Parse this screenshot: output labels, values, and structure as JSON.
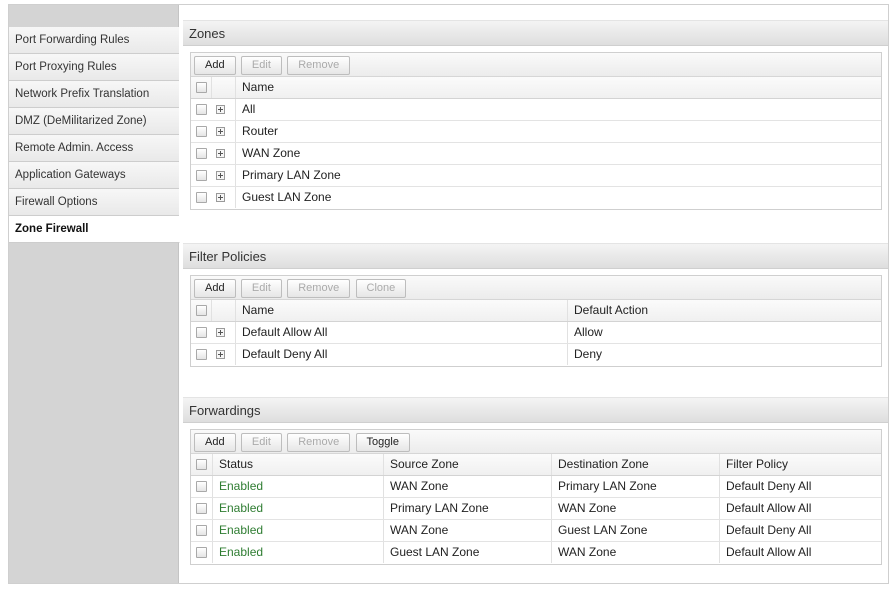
{
  "sidebar": {
    "items": [
      {
        "label": "Port Forwarding Rules"
      },
      {
        "label": "Port Proxying Rules"
      },
      {
        "label": "Network Prefix Translation"
      },
      {
        "label": "DMZ (DeMilitarized Zone)"
      },
      {
        "label": "Remote Admin. Access"
      },
      {
        "label": "Application Gateways"
      },
      {
        "label": "Firewall Options"
      },
      {
        "label": "Zone Firewall"
      }
    ],
    "active": "Zone Firewall"
  },
  "zones": {
    "title": "Zones",
    "buttons": {
      "add": "Add",
      "edit": "Edit",
      "remove": "Remove"
    },
    "header": {
      "name": "Name"
    },
    "rows": [
      "All",
      "Router",
      "WAN Zone",
      "Primary LAN Zone",
      "Guest LAN Zone"
    ]
  },
  "filter_policies": {
    "title": "Filter Policies",
    "buttons": {
      "add": "Add",
      "edit": "Edit",
      "remove": "Remove",
      "clone": "Clone"
    },
    "header": {
      "name": "Name",
      "default_action": "Default Action"
    },
    "rows": [
      {
        "name": "Default Allow All",
        "action": "Allow"
      },
      {
        "name": "Default Deny All",
        "action": "Deny"
      }
    ]
  },
  "forwardings": {
    "title": "Forwardings",
    "buttons": {
      "add": "Add",
      "edit": "Edit",
      "remove": "Remove",
      "toggle": "Toggle"
    },
    "header": {
      "status": "Status",
      "source": "Source Zone",
      "destination": "Destination Zone",
      "policy": "Filter Policy"
    },
    "rows": [
      {
        "status": "Enabled",
        "source": "WAN Zone",
        "destination": "Primary LAN Zone",
        "policy": "Default Deny All"
      },
      {
        "status": "Enabled",
        "source": "Primary LAN Zone",
        "destination": "WAN Zone",
        "policy": "Default Allow All"
      },
      {
        "status": "Enabled",
        "source": "WAN Zone",
        "destination": "Guest LAN Zone",
        "policy": "Default Deny All"
      },
      {
        "status": "Enabled",
        "source": "Guest LAN Zone",
        "destination": "WAN Zone",
        "policy": "Default Allow All"
      }
    ]
  },
  "colors": {
    "enabled_status": "#2f7d32",
    "sidebar_bg": "#d4d4d4",
    "panel_header": "#dedede"
  },
  "icons": {
    "expand": "plus-square-icon",
    "select": "checkbox-icon"
  }
}
